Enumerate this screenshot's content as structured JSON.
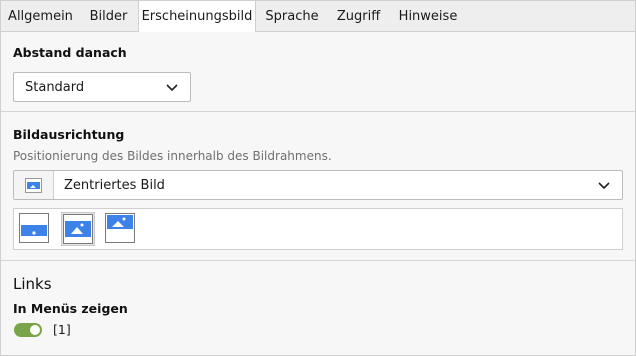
{
  "tabs": [
    {
      "label": "Allgemein"
    },
    {
      "label": "Bilder"
    },
    {
      "label": "Erscheinungsbild",
      "active": true
    },
    {
      "label": "Sprache"
    },
    {
      "label": "Zugriff"
    },
    {
      "label": "Hinweise"
    }
  ],
  "spacing": {
    "label": "Abstand danach",
    "value": "Standard"
  },
  "image_alignment": {
    "label": "Bildausrichtung",
    "description": "Positionierung des Bildes innerhalb des Bildrahmens.",
    "value": "Zentriertes Bild",
    "options": [
      {
        "name": "align-bottom",
        "selected": false
      },
      {
        "name": "align-center",
        "selected": true
      },
      {
        "name": "align-top",
        "selected": false
      }
    ]
  },
  "links": {
    "title": "Links",
    "show_in_menus_label": "In Menüs zeigen",
    "toggle_value": "[1]",
    "toggle_on": true
  },
  "colors": {
    "accent_blue": "#3d82e8",
    "toggle_green": "#79a548"
  }
}
